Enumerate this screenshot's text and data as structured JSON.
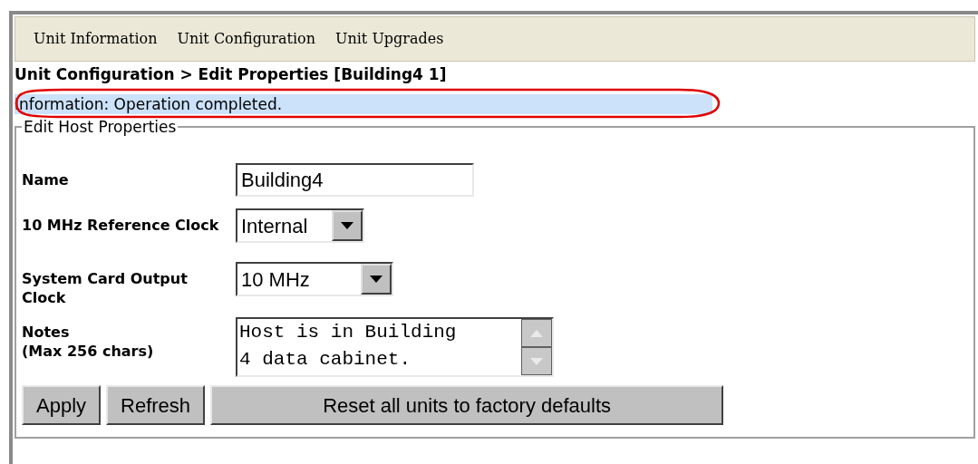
{
  "menu": [
    {
      "label": "Unit Information"
    },
    {
      "label": "Unit Configuration"
    },
    {
      "label": "Unit Upgrades"
    }
  ],
  "breadcrumb": "Unit Configuration > Edit Properties [Building4 1]",
  "message": {
    "text": "Information: Operation completed.",
    "highlighted": true
  },
  "form": {
    "legend": "Edit Host Properties",
    "fields": [
      {
        "kind": "text",
        "label": "Name",
        "value": "Building4"
      },
      {
        "kind": "select",
        "label": "10 MHz Reference Clock",
        "value": "Internal"
      },
      {
        "kind": "select",
        "label": "System Card Output Clock",
        "value": "10 MHz"
      },
      {
        "kind": "textarea",
        "label": "Notes\n(Max 256 chars)",
        "value": "Host is in Building\n4 data cabinet."
      }
    ],
    "buttons": [
      {
        "label": "Apply"
      },
      {
        "label": "Refresh"
      },
      {
        "label": "Reset all units to factory defaults"
      }
    ]
  }
}
